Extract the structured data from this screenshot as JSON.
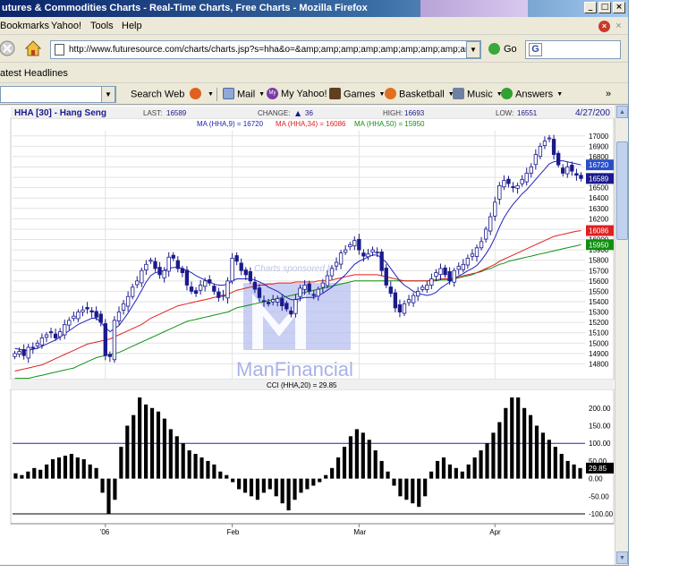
{
  "window": {
    "title": "utures & Commodities Charts - Real-Time Charts, Free Charts - Mozilla Firefox",
    "buttons": {
      "minimize": "_",
      "maximize": "□",
      "close": "×"
    }
  },
  "menubar": {
    "items": [
      "Bookmarks",
      "Yahoo!",
      "Tools",
      "Help"
    ]
  },
  "navbar": {
    "url": "http://www.futuresource.com/charts/charts.jsp?s=hha&o=&amp;amp;amp;amp;amp;amp;amp;amp;amp;amp;a",
    "go_label": "Go",
    "search_engine_glyph": "G"
  },
  "headlines": {
    "label": "atest Headlines"
  },
  "yahoo_toolbar": {
    "search_web": "Search Web",
    "mail": "Mail",
    "my_yahoo": "My Yahoo!",
    "games": "Games",
    "basketball": "Basketball",
    "music": "Music",
    "answers": "Answers",
    "more": "»",
    "myyahoo_badge": "My"
  },
  "chart_header": {
    "symbol": "HHA [30] - Hang Seng",
    "last_label": "LAST:",
    "last": "16589",
    "change_label": "CHANGE:",
    "change": "36",
    "change_arrow": "▲",
    "high_label": "HIGH:",
    "high": "16693",
    "low_label": "LOW:",
    "low": "16551",
    "date": "4/27/200",
    "ma9": "MA (HHA,9) = 16720",
    "ma34": "MA (HHA,34) = 16086",
    "ma50": "MA (HHA,50) = 15950",
    "watermark_sponsor": "Charts sponsored by",
    "watermark_brand": "ManFinancial",
    "badges": {
      "ma9": "16720",
      "last": "16589",
      "ma34": "16086",
      "ma50": "15950"
    },
    "colors": {
      "ma9": "#2020c0",
      "ma34": "#e02020",
      "ma50": "#109010",
      "candle": "#1a1a8c"
    }
  },
  "chart_data": [
    {
      "type": "candlestick",
      "title": "HHA [30] - Hang Seng",
      "ylim": [
        14700,
        17050
      ],
      "yticks": [
        14800,
        14900,
        15000,
        15100,
        15200,
        15300,
        15400,
        15500,
        15600,
        15700,
        15800,
        15900,
        16000,
        16100,
        16200,
        16300,
        16400,
        16500,
        16600,
        16700,
        16800,
        16900,
        17000
      ],
      "xticks": [
        "'06",
        "Feb",
        "Mar",
        "Apr"
      ],
      "xtick_index": [
        20,
        48,
        76,
        106
      ],
      "grid": true,
      "n": 126,
      "close": [
        14900,
        14920,
        14880,
        14960,
        14950,
        15000,
        15050,
        15080,
        15100,
        15050,
        15110,
        15180,
        15220,
        15260,
        15300,
        15320,
        15330,
        15300,
        15250,
        15200,
        14880,
        14870,
        15220,
        15300,
        15380,
        15450,
        15540,
        15600,
        15700,
        15760,
        15800,
        15720,
        15660,
        15700,
        15830,
        15820,
        15720,
        15680,
        15560,
        15500,
        15480,
        15560,
        15600,
        15580,
        15500,
        15440,
        15460,
        15600,
        15820,
        15790,
        15700,
        15660,
        15600,
        15520,
        15440,
        15400,
        15380,
        15420,
        15430,
        15360,
        15330,
        15280,
        15420,
        15530,
        15560,
        15500,
        15460,
        15520,
        15580,
        15650,
        15720,
        15780,
        15870,
        15900,
        15950,
        15990,
        15900,
        15840,
        15860,
        15900,
        15880,
        15700,
        15560,
        15480,
        15340,
        15300,
        15380,
        15420,
        15460,
        15500,
        15540,
        15560,
        15620,
        15680,
        15720,
        15660,
        15600,
        15700,
        15740,
        15760,
        15820,
        15860,
        15920,
        15980,
        16100,
        16220,
        16360,
        16520,
        16570,
        16540,
        16500,
        16520,
        16580,
        16640,
        16700,
        16820,
        16900,
        16950,
        16980,
        16820,
        16720,
        16640,
        16700,
        16660,
        16620,
        16589
      ],
      "ma9": [
        14950,
        14940,
        14930,
        14930,
        14940,
        14950,
        14970,
        14990,
        15010,
        15030,
        15060,
        15090,
        15120,
        15150,
        15180,
        15200,
        15220,
        15240,
        15240,
        15200,
        15150,
        15110,
        15140,
        15170,
        15230,
        15290,
        15360,
        15430,
        15510,
        15590,
        15650,
        15680,
        15690,
        15700,
        15720,
        15730,
        15730,
        15720,
        15700,
        15680,
        15650,
        15630,
        15610,
        15590,
        15570,
        15560,
        15560,
        15570,
        15600,
        15620,
        15620,
        15620,
        15620,
        15610,
        15590,
        15570,
        15540,
        15520,
        15500,
        15470,
        15440,
        15420,
        15420,
        15430,
        15440,
        15440,
        15440,
        15460,
        15480,
        15510,
        15540,
        15580,
        15620,
        15660,
        15710,
        15760,
        15790,
        15810,
        15830,
        15850,
        15850,
        15820,
        15780,
        15720,
        15660,
        15600,
        15560,
        15530,
        15500,
        15480,
        15470,
        15460,
        15470,
        15490,
        15530,
        15560,
        15590,
        15620,
        15650,
        15670,
        15700,
        15720,
        15750,
        15800,
        15860,
        15930,
        16020,
        16120,
        16210,
        16280,
        16340,
        16390,
        16440,
        16480,
        16530,
        16580,
        16630,
        16680,
        16730,
        16750,
        16760,
        16760,
        16750,
        16740,
        16730,
        16720
      ],
      "ma34": [
        14730,
        14740,
        14750,
        14760,
        14770,
        14780,
        14790,
        14810,
        14830,
        14850,
        14870,
        14890,
        14910,
        14930,
        14950,
        14970,
        14990,
        15000,
        15010,
        15020,
        15030,
        15040,
        15060,
        15080,
        15100,
        15120,
        15140,
        15160,
        15180,
        15210,
        15240,
        15260,
        15280,
        15300,
        15320,
        15340,
        15360,
        15370,
        15380,
        15390,
        15400,
        15410,
        15420,
        15430,
        15440,
        15450,
        15460,
        15470,
        15490,
        15510,
        15520,
        15530,
        15540,
        15550,
        15560,
        15560,
        15570,
        15570,
        15580,
        15580,
        15580,
        15580,
        15590,
        15590,
        15590,
        15590,
        15590,
        15600,
        15600,
        15600,
        15610,
        15620,
        15630,
        15640,
        15650,
        15660,
        15660,
        15660,
        15660,
        15660,
        15660,
        15650,
        15640,
        15630,
        15620,
        15610,
        15600,
        15600,
        15600,
        15600,
        15600,
        15600,
        15610,
        15610,
        15620,
        15620,
        15620,
        15630,
        15640,
        15650,
        15660,
        15670,
        15680,
        15700,
        15720,
        15740,
        15760,
        15790,
        15810,
        15830,
        15850,
        15870,
        15890,
        15910,
        15930,
        15950,
        15970,
        15990,
        16010,
        16030,
        16040,
        16050,
        16060,
        16070,
        16080,
        16086
      ],
      "ma50": [
        14660,
        14660,
        14660,
        14660,
        14670,
        14680,
        14690,
        14700,
        14710,
        14720,
        14730,
        14740,
        14750,
        14760,
        14780,
        14800,
        14820,
        14840,
        14860,
        14870,
        14880,
        14890,
        14900,
        14910,
        14930,
        14950,
        14970,
        14990,
        15010,
        15030,
        15050,
        15070,
        15090,
        15110,
        15130,
        15150,
        15170,
        15190,
        15210,
        15220,
        15230,
        15240,
        15250,
        15260,
        15270,
        15280,
        15290,
        15300,
        15320,
        15340,
        15350,
        15360,
        15370,
        15380,
        15390,
        15400,
        15410,
        15420,
        15430,
        15440,
        15450,
        15460,
        15470,
        15480,
        15490,
        15500,
        15510,
        15520,
        15530,
        15540,
        15550,
        15560,
        15570,
        15580,
        15590,
        15600,
        15600,
        15600,
        15600,
        15600,
        15600,
        15600,
        15600,
        15600,
        15600,
        15600,
        15600,
        15600,
        15600,
        15600,
        15600,
        15600,
        15600,
        15600,
        15610,
        15610,
        15610,
        15620,
        15630,
        15640,
        15650,
        15660,
        15680,
        15690,
        15710,
        15720,
        15740,
        15760,
        15770,
        15790,
        15800,
        15810,
        15820,
        15830,
        15840,
        15850,
        15860,
        15870,
        15880,
        15890,
        15900,
        15910,
        15920,
        15930,
        15940,
        15950
      ]
    },
    {
      "type": "bar",
      "title": "CCI (HHA,20) = 29.85",
      "ylim": [
        -110,
        240
      ],
      "yticks": [
        -100,
        -50,
        0,
        50,
        100,
        150,
        200
      ],
      "ytick_labels": [
        "-100.00",
        "-50.00",
        "0.00",
        "50.00",
        "100.00",
        "150.00",
        "200.00"
      ],
      "current_label": "29.85",
      "reference_lines": [
        100,
        -100
      ],
      "values": [
        15,
        10,
        20,
        30,
        25,
        40,
        55,
        60,
        65,
        70,
        60,
        55,
        40,
        30,
        -40,
        -100,
        -60,
        90,
        150,
        180,
        230,
        210,
        200,
        190,
        170,
        140,
        120,
        100,
        80,
        70,
        60,
        50,
        40,
        20,
        10,
        -10,
        -30,
        -40,
        -50,
        -60,
        -40,
        -30,
        -50,
        -70,
        -90,
        -60,
        -40,
        -30,
        -20,
        -10,
        10,
        30,
        60,
        90,
        120,
        140,
        130,
        110,
        80,
        50,
        20,
        -20,
        -50,
        -60,
        -70,
        -80,
        -50,
        20,
        50,
        60,
        40,
        30,
        20,
        40,
        60,
        80,
        100,
        130,
        160,
        200,
        230,
        230,
        200,
        180,
        150,
        130,
        110,
        90,
        70,
        50,
        40,
        29.85
      ]
    }
  ]
}
